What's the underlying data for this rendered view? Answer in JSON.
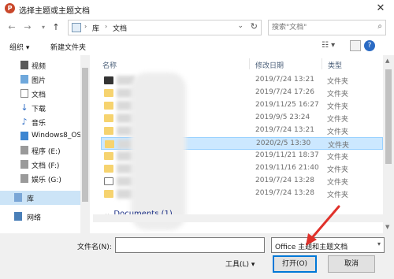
{
  "window": {
    "title": "选择主题或主题文档",
    "app_icon": "P"
  },
  "nav": {
    "back_icon": "←",
    "forward_icon": "→",
    "up_icon": "↑",
    "address": [
      "库",
      "文档"
    ],
    "search_placeholder": "搜索\"文档\""
  },
  "toolbar": {
    "organize": "组织 ▾",
    "new_folder": "新建文件夹"
  },
  "sidebar": {
    "items": [
      {
        "label": "视频",
        "icon": "video-icon"
      },
      {
        "label": "图片",
        "icon": "picture-icon"
      },
      {
        "label": "文档",
        "icon": "document-icon"
      },
      {
        "label": "下载",
        "icon": "download-icon"
      },
      {
        "label": "音乐",
        "icon": "music-icon"
      },
      {
        "label": "Windows8_OS",
        "icon": "drive-icon"
      },
      {
        "label": "程序 (E:)",
        "icon": "drive-icon"
      },
      {
        "label": "文档 (F:)",
        "icon": "drive-icon"
      },
      {
        "label": "娱乐 (G:)",
        "icon": "drive-icon"
      },
      {
        "label": "库",
        "icon": "library-icon"
      },
      {
        "label": "网络",
        "icon": "network-icon"
      }
    ]
  },
  "columns": {
    "name": "名称",
    "date": "修改日期",
    "type": "类型"
  },
  "files": [
    {
      "date": "2019/7/24 13:21",
      "type": "文件夹",
      "icon": "app",
      "selected": false
    },
    {
      "date": "2019/7/24 17:26",
      "type": "文件夹",
      "icon": "folder",
      "selected": false
    },
    {
      "date": "2019/11/25 16:27",
      "type": "文件夹",
      "icon": "folder",
      "selected": false
    },
    {
      "date": "2019/9/5 23:24",
      "type": "文件夹",
      "icon": "folder",
      "selected": false
    },
    {
      "date": "2019/7/24 13:21",
      "type": "文件夹",
      "icon": "folder",
      "selected": false
    },
    {
      "date": "2020/2/5 13:30",
      "type": "文件夹",
      "icon": "folder",
      "selected": true
    },
    {
      "date": "2019/11/21 18:37",
      "type": "文件夹",
      "icon": "folder",
      "selected": false
    },
    {
      "date": "2019/11/16 21:40",
      "type": "文件夹",
      "icon": "folder",
      "selected": false
    },
    {
      "date": "2019/7/24 13:28",
      "type": "文件夹",
      "icon": "doc",
      "selected": false
    },
    {
      "date": "2019/7/24 13:28",
      "type": "文件夹",
      "icon": "folder",
      "selected": false
    }
  ],
  "group_header": "Documents (1)",
  "bottom": {
    "filename_label": "文件名(N):",
    "filename_value": "",
    "filter": "Office 主题和主题文档",
    "tools": "工具(L) ▾",
    "open": "打开(O)",
    "cancel": "取消"
  },
  "accent": "#0078d7",
  "selection_color": "#cce8ff",
  "annotation_arrow_color": "#e0312a"
}
